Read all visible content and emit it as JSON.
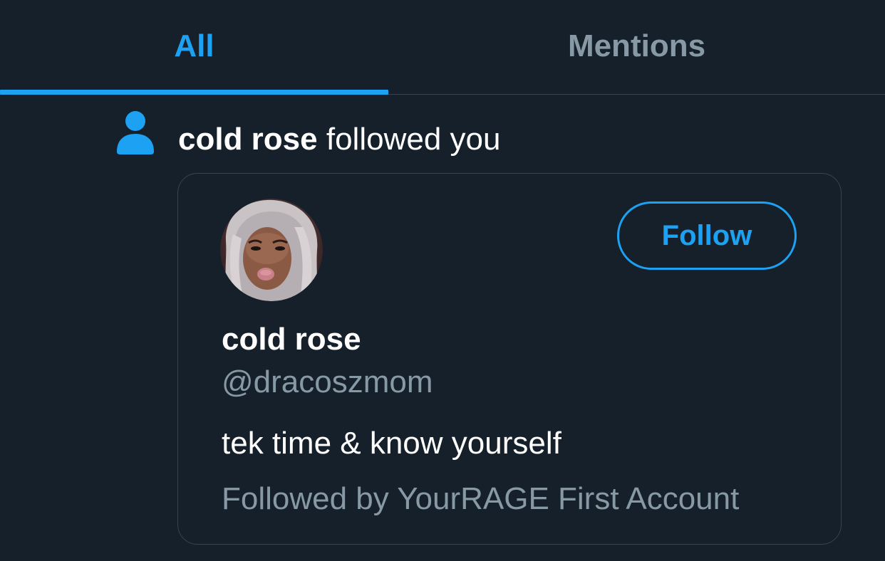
{
  "tabs": [
    {
      "label": "All",
      "active": true
    },
    {
      "label": "Mentions",
      "active": false
    }
  ],
  "notification": {
    "icon": "person-icon",
    "actor": "cold rose",
    "action": " followed you"
  },
  "card": {
    "display_name": "cold rose",
    "handle": "@dracoszmom",
    "bio": "tek time & know yourself",
    "followed_by": "Followed by YourRAGE First Account",
    "follow_label": "Follow"
  },
  "colors": {
    "background": "#15202b",
    "accent": "#1da1f2",
    "text_primary": "#ffffff",
    "text_secondary": "#8899a6",
    "border": "#38444d"
  }
}
